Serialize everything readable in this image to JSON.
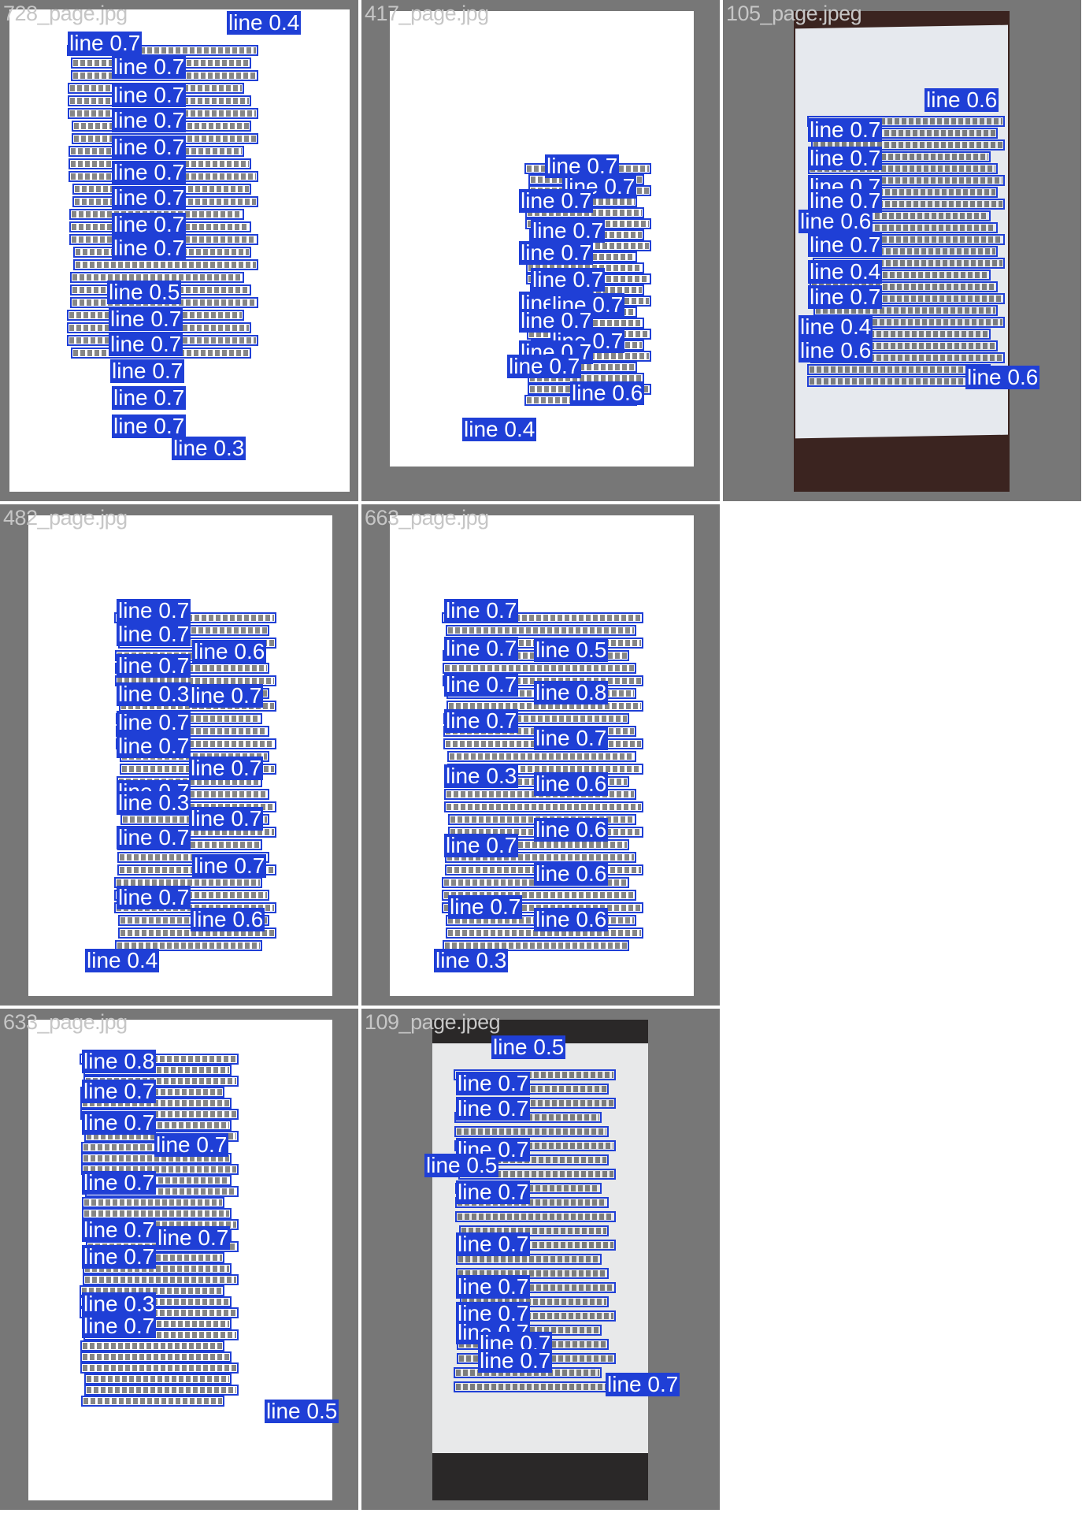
{
  "panels": [
    {
      "file": "728_page.jpg",
      "detections": [
        {
          "label": "line 0.4"
        },
        {
          "label": "line 0.7"
        },
        {
          "label": "line 0.7"
        },
        {
          "label": "line 0.7"
        },
        {
          "label": "line 0.7"
        },
        {
          "label": "line 0.7"
        },
        {
          "label": "line 0.7"
        },
        {
          "label": "line 0.7"
        },
        {
          "label": "line 0.7"
        },
        {
          "label": "line 0.7"
        },
        {
          "label": "line 0.5"
        },
        {
          "label": "line 0.7"
        },
        {
          "label": "line 0.7"
        },
        {
          "label": "line 0.7"
        },
        {
          "label": "line 0.7"
        },
        {
          "label": "line 0.7"
        },
        {
          "label": "line 0.3"
        }
      ]
    },
    {
      "file": "417_page.jpg",
      "detections": [
        {
          "label": "line 0.7"
        },
        {
          "label": "line 0.7"
        },
        {
          "label": "line 0.7"
        },
        {
          "label": "line 0.7"
        },
        {
          "label": "line 0.7"
        },
        {
          "label": "line 0.7"
        },
        {
          "label": "line 0.7"
        },
        {
          "label": "line 0.7"
        },
        {
          "label": "line 0.7"
        },
        {
          "label": "line 0.7"
        },
        {
          "label": "line 0.7"
        },
        {
          "label": "line 0.7"
        },
        {
          "label": "line 0.6"
        },
        {
          "label": "line 0.4"
        }
      ]
    },
    {
      "file": "105_page.jpeg",
      "detections": [
        {
          "label": "line 0.6"
        },
        {
          "label": "line 0.7"
        },
        {
          "label": "line 0.7"
        },
        {
          "label": "line 0.7"
        },
        {
          "label": "line 0.7"
        },
        {
          "label": "line 0.6"
        },
        {
          "label": "line 0.7"
        },
        {
          "label": "line 0.4"
        },
        {
          "label": "line 0.7"
        },
        {
          "label": "line 0.4"
        },
        {
          "label": "line 0.6"
        },
        {
          "label": "line 0.6"
        }
      ]
    },
    {
      "file": "482_page.jpg",
      "detections": [
        {
          "label": "line 0.7"
        },
        {
          "label": "line 0.7"
        },
        {
          "label": "line 0.6"
        },
        {
          "label": "line 0.7"
        },
        {
          "label": "line 0.3"
        },
        {
          "label": "line 0.7"
        },
        {
          "label": "line 0.7"
        },
        {
          "label": "line 0.7"
        },
        {
          "label": "line 0.7"
        },
        {
          "label": "line 0.7"
        },
        {
          "label": "line 0.3"
        },
        {
          "label": "line 0.7"
        },
        {
          "label": "line 0.7"
        },
        {
          "label": "line 0.7"
        },
        {
          "label": "line 0.7"
        },
        {
          "label": "line 0.6"
        },
        {
          "label": "line 0.4"
        }
      ]
    },
    {
      "file": "663_page.jpg",
      "detections": [
        {
          "label": "line 0.7"
        },
        {
          "label": "line 0.7"
        },
        {
          "label": "line 0.7"
        },
        {
          "label": "line 0.5"
        },
        {
          "label": "line 0.7"
        },
        {
          "label": "line 0.8"
        },
        {
          "label": "line 0.7"
        },
        {
          "label": "line 0.7"
        },
        {
          "label": "line 0.3"
        },
        {
          "label": "line 0.6"
        },
        {
          "label": "line 0.6"
        },
        {
          "label": "line 0.7"
        },
        {
          "label": "line 0.6"
        },
        {
          "label": "line 0.7"
        },
        {
          "label": "line 0.6"
        },
        {
          "label": "line 0.3"
        }
      ]
    },
    {
      "file": "633_page.jpg",
      "detections": [
        {
          "label": "line 0.8"
        },
        {
          "label": "line 0.7"
        },
        {
          "label": "line 0.7"
        },
        {
          "label": "line 0.7"
        },
        {
          "label": "line 0.7"
        },
        {
          "label": "line 0.7"
        },
        {
          "label": "line 0.7"
        },
        {
          "label": "line 0.7"
        },
        {
          "label": "line 0.3"
        },
        {
          "label": "line 0.7"
        },
        {
          "label": "line 0.5"
        }
      ]
    },
    {
      "file": "109_page.jpeg",
      "detections": [
        {
          "label": "line 0.5"
        },
        {
          "label": "line 0.7"
        },
        {
          "label": "line 0.7"
        },
        {
          "label": "line 0.7"
        },
        {
          "label": "line 0.5"
        },
        {
          "label": "line 0.7"
        },
        {
          "label": "line 0.7"
        },
        {
          "label": "line 0.7"
        },
        {
          "label": "line 0.7"
        },
        {
          "label": "line 0.7"
        },
        {
          "label": "line 0.7"
        },
        {
          "label": "line 0.7"
        },
        {
          "label": "line 0.7"
        }
      ]
    }
  ],
  "colors": {
    "box": "#1f3fd6",
    "panel_bg": "#777777",
    "filename_text": "#c6c6c6"
  }
}
